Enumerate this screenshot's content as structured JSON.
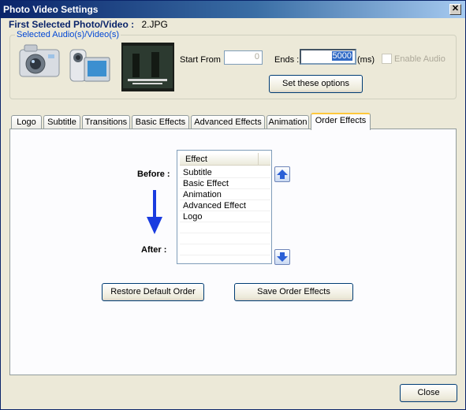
{
  "window": {
    "title": "Photo Video Settings",
    "close_glyph": "✕"
  },
  "selection": {
    "first_label": "First Selected Photo/Video :",
    "first_value": "2.JPG",
    "audio_legend": "Selected Audio(s)/Video(s)"
  },
  "thumbnails": {
    "icons": [
      "camera-icon",
      "camcorder-icon",
      "video-preview-thumbnail"
    ]
  },
  "timing": {
    "start_label": "Start From :",
    "start_value": "0",
    "ends_label": "Ends :",
    "ends_value": "5000",
    "ends_unit": "(ms)",
    "enable_audio_label": "Enable Audio",
    "enable_audio_checked": false,
    "set_button": "Set these options"
  },
  "tabs": [
    "Logo",
    "Subtitle",
    "Transitions",
    "Basic Effects",
    "Advanced Effects",
    "Animation",
    "Order Effects"
  ],
  "active_tab": "Order Effects",
  "order": {
    "before_label": "Before :",
    "after_label": "After :",
    "column_header": "Effect",
    "items": [
      "Subtitle",
      "Basic Effect",
      "Animation",
      "Advanced Effect",
      "Logo"
    ],
    "restore_button": "Restore Default Order",
    "save_button": "Save Order Effects"
  },
  "footer": {
    "close_button": "Close"
  },
  "colors": {
    "accent_blue": "#0a246a",
    "arrow_blue": "#1a3ce0",
    "active_tab_top": "#ffc83c"
  }
}
